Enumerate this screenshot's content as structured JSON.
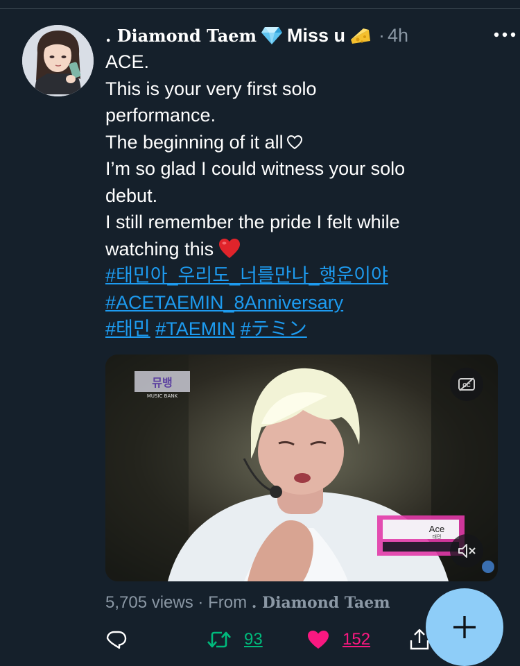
{
  "tweet": {
    "display_name": ". Diamond Taem",
    "name_suffix": "Miss u",
    "separator": "·",
    "time": "4h",
    "text_lines": [
      "ACE.",
      "This is your very first solo",
      "performance.",
      "The beginning of it all",
      "I’m so glad I could witness your solo",
      "debut.",
      "I still remember the pride I felt while",
      "watching this"
    ],
    "hashtags": [
      "#태민아_우리도_너를만나_행운이야",
      "#ACETAEMIN_8Anniversary",
      "#태민",
      "#TAEMIN",
      "#テミン"
    ]
  },
  "media": {
    "broadcast_logo": "MUSIC BANK",
    "song_title": "Ace",
    "artist_caption": "태민",
    "cc_icon": "closed-captions-off-icon",
    "mute_icon": "volume-muted-icon"
  },
  "meta": {
    "views_text": "5,705 views · From",
    "source_name": ". Diamond Taem"
  },
  "actions": {
    "retweet_count": "93",
    "like_count": "152",
    "reply_icon": "reply-icon",
    "retweet_icon": "retweet-icon",
    "like_icon": "heart-filled-icon",
    "share_icon": "share-icon"
  },
  "fab": {
    "icon": "plus-icon"
  },
  "colors": {
    "background": "#15202b",
    "link": "#1d9bf0",
    "retweet_green": "#00ba7c",
    "like_pink": "#f91880",
    "secondary_text": "#8b98a5",
    "fab": "#8ecdf8"
  }
}
